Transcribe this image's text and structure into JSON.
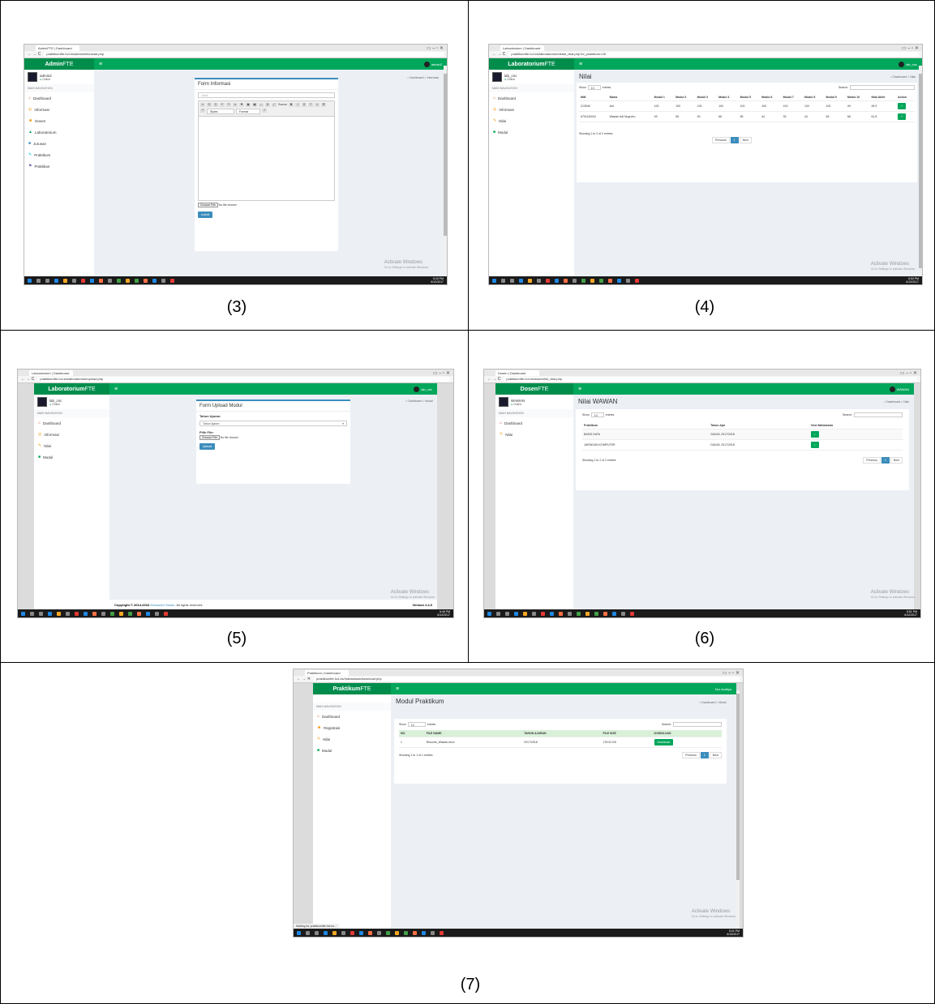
{
  "captions": [
    "(3)",
    "(4)",
    "(5)",
    "(6)",
    "(7)"
  ],
  "shot3": {
    "tab": "AdminFTE | Dashboard",
    "url": "praktikumfte.hol.es/admin/informasi.php",
    "brand_bold": "Admin",
    "brand_thin": "FTE",
    "header_user": "admin2",
    "sidebar_user": "admin2",
    "online": "Online",
    "nav_head": "MAIN NAVIGATION",
    "nav": [
      {
        "icon": "⌂",
        "label": "Dashboard"
      },
      {
        "icon": "◎",
        "label": "Informasi"
      },
      {
        "icon": "☻",
        "label": "Dosen"
      },
      {
        "icon": "▲",
        "label": "Laboratorium"
      },
      {
        "icon": "■",
        "label": "Jurusan"
      },
      {
        "icon": "✎",
        "label": "Praktikum"
      },
      {
        "icon": "⚑",
        "label": "Praktikan"
      }
    ],
    "crumb": "Dashboard > Informasi",
    "form_title": "Form Informasi",
    "judul_placeholder": "Judul",
    "toolbar_source": "Source",
    "toolbar_styles": "Styles",
    "toolbar_format": "Format",
    "file_button": "Choose File",
    "file_none": "No file chosen",
    "submit": "submit",
    "clock_time": "5:43 PM",
    "clock_date": "6/12/2017"
  },
  "shot4": {
    "tab": "Laboratorium | Dashboard",
    "url": "praktikumfte.hol.es/laboratorium/detail_nilai.php?id_praktikum=28",
    "brand_bold": "Laboratorium",
    "brand_thin": "FTE",
    "header_user": "lab_cnc",
    "sidebar_user": "lab_cnc",
    "online": "Online",
    "nav_head": "MAIN NAVIGATION",
    "nav": [
      {
        "icon": "⌂",
        "label": "Dashboard"
      },
      {
        "icon": "◎",
        "label": "Informasi"
      },
      {
        "icon": "✎",
        "label": "Nilai"
      },
      {
        "icon": "■",
        "label": "Modul"
      }
    ],
    "title": "Nilai",
    "crumb": "Dashboard > Nilai",
    "show": "Show",
    "entries_val": "10",
    "entries": "entries",
    "search": "Search:",
    "headers": [
      "NIM",
      "Nama",
      "Modul 1",
      "Modul 2",
      "Modul 3",
      "Modul 4",
      "Modul 5",
      "Modul 6",
      "Modul 7",
      "Modul 8",
      "Modul 9",
      "Modul 10",
      "Nilai Akhir",
      "Action"
    ],
    "rows": [
      [
        "213546",
        "Adi",
        "100",
        "100",
        "100",
        "100",
        "100",
        "100",
        "100",
        "100",
        "100",
        "99",
        "99.9"
      ],
      [
        "6701140041",
        "Wawan Adi Nugroho",
        "99",
        "55",
        "90",
        "66",
        "55",
        "44",
        "33",
        "44",
        "66",
        "66",
        "61.8"
      ]
    ],
    "info": "Showing 1 to 2 of 2 entries",
    "prev": "Previous",
    "page": "1",
    "next": "Next",
    "clock_time": "5:50 PM",
    "clock_date": "6/12/2017"
  },
  "shot5": {
    "tab": "Laboratorium | Dashboard",
    "url": "praktikumfte.hol.es/laboratorium/upload.php",
    "brand_bold": "Laboratorium",
    "brand_thin": "FTE",
    "header_user": "lab_cnc",
    "sidebar_user": "lab_cnc",
    "online": "Online",
    "nav_head": "MAIN NAVIGATION",
    "nav": [
      {
        "icon": "⌂",
        "label": "Dashboard"
      },
      {
        "icon": "◎",
        "label": "Informasi"
      },
      {
        "icon": "✎",
        "label": "Nilai"
      },
      {
        "icon": "■",
        "label": "Modul"
      }
    ],
    "crumb": "Dashboard > Modul",
    "form_title": "Form Upload Modul",
    "tahun_label": "Tahun Ajaran:",
    "tahun_select": "Tahun Ajaran",
    "file_label": "Pilih File:",
    "file_button": "Choose File",
    "file_none": "No file chosen",
    "upload": "Upload",
    "footer_copy": "Copyright © 2014-2016",
    "footer_company": "Almsaeed Studio.",
    "footer_rights": "All rights reserved.",
    "footer_version": "Version 2.4.0",
    "clock_time": "5:46 PM",
    "clock_date": "6/12/2017"
  },
  "shot6": {
    "tab": "Dosen | Dashboard",
    "url": "praktikumfte.hol.es/dosen/list_nilai.php",
    "brand_bold": "Dosen",
    "brand_thin": "FTE",
    "header_user": "WAWAN",
    "sidebar_user": "WAWAN",
    "online": "Online",
    "nav_head": "MAIN NAVIGATION",
    "nav": [
      {
        "icon": "⌂",
        "label": "Dashboard"
      },
      {
        "icon": "✎",
        "label": "Nilai"
      }
    ],
    "title": "Nilai WAWAN",
    "crumb": "Dashboard > Nilai",
    "show": "Show",
    "entries_val": "10",
    "entries": "entries",
    "search": "Search:",
    "headers": [
      "Praktikum",
      "Tahun Ajar",
      "View Mahasiswa"
    ],
    "rows": [
      [
        "BASIS DATA",
        "GANJIL 2017/2018"
      ],
      [
        "JARINGAN KOMPUTER",
        "GANJIL 2017/2018"
      ]
    ],
    "info": "Showing 1 to 2 of 2 entries",
    "prev": "Previous",
    "page": "1",
    "next": "Next",
    "clock_time": "5:51 PM",
    "clock_date": "6/12/2017"
  },
  "shot7": {
    "tab": "Praktikum | Dashboard",
    "url": "praktikumfte.hol.es/mahasiswa/download.php",
    "brand_bold": "Praktikum",
    "brand_thin": "FTE",
    "header_user": "Nur Azaliya",
    "nav_head": "MAIN NAVIGATION",
    "nav": [
      {
        "icon": "⌂",
        "label": "Dashboard"
      },
      {
        "icon": "☻",
        "label": "Registrasi"
      },
      {
        "icon": "✎",
        "label": "Nilai"
      },
      {
        "icon": "■",
        "label": "Modul"
      }
    ],
    "title": "Modul Praktikum",
    "crumb": "Dashboard > Modul",
    "show": "Show",
    "entries_val": "10",
    "entries": "entries",
    "search": "Search:",
    "headers": [
      "NO.",
      "FILE NAME",
      "TAHUN AJARAN",
      "FILE SIZE",
      "DOWNLOAD"
    ],
    "rows": [
      [
        "1",
        "Resume_Wawan.docx",
        "2017/2018",
        "178.92 KB"
      ]
    ],
    "download": "Download",
    "info": "Showing 1 to 1 of 1 entries",
    "prev": "Previous",
    "page": "1",
    "next": "Next",
    "status": "Waiting for praktikumfte.hol.es...",
    "clock_time": "5:21 PM",
    "clock_date": "6/13/2017"
  },
  "activate": {
    "title": "Activate Windows",
    "sub": "Go to Settings to activate Windows."
  }
}
